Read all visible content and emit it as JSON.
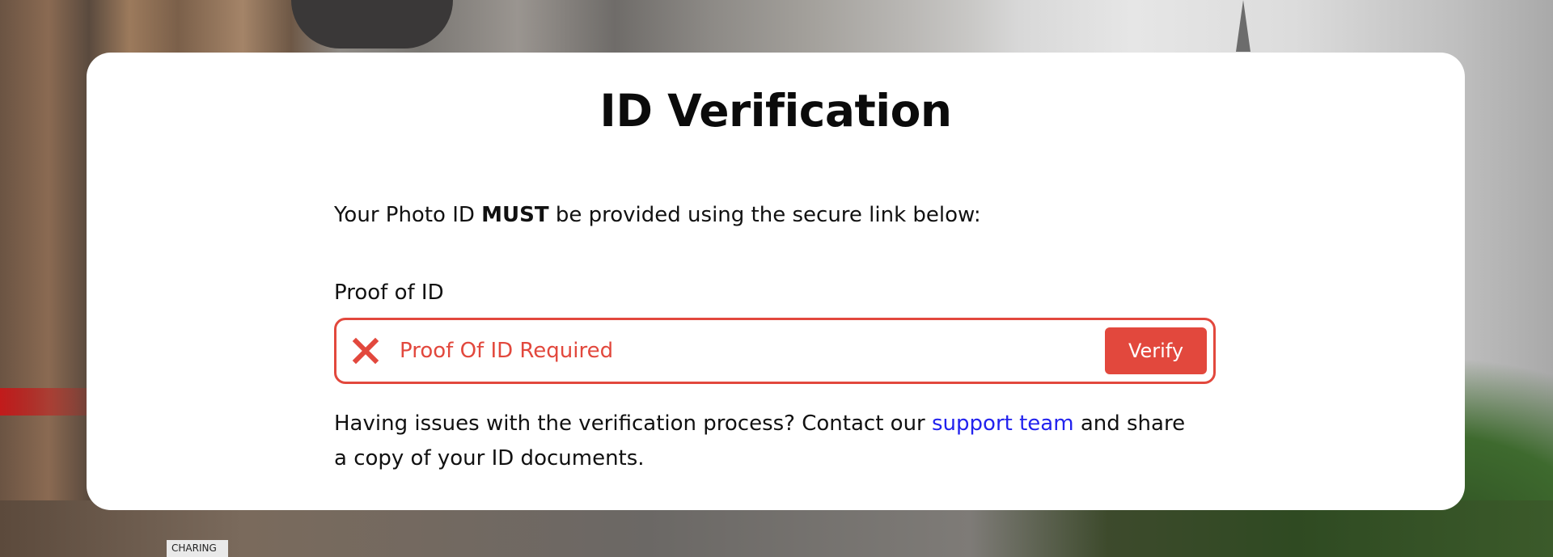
{
  "page": {
    "title": "ID Verification",
    "intro_prefix": "Your Photo ID ",
    "intro_emphasis": "MUST",
    "intro_suffix": " be provided using the secure link below:"
  },
  "proof_field": {
    "label": "Proof of ID",
    "status_icon": "x-icon",
    "status_text": "Proof Of ID Required",
    "status_color": "#e2483d",
    "verify_label": "Verify"
  },
  "help": {
    "prefix": "Having issues with the verification process? Contact our ",
    "link_text": "support team",
    "suffix": " and share a copy of your ID documents."
  },
  "background": {
    "sign_text": "CHARING"
  },
  "colors": {
    "accent": "#e2483d",
    "link": "#2222ee",
    "card": "#ffffff"
  }
}
